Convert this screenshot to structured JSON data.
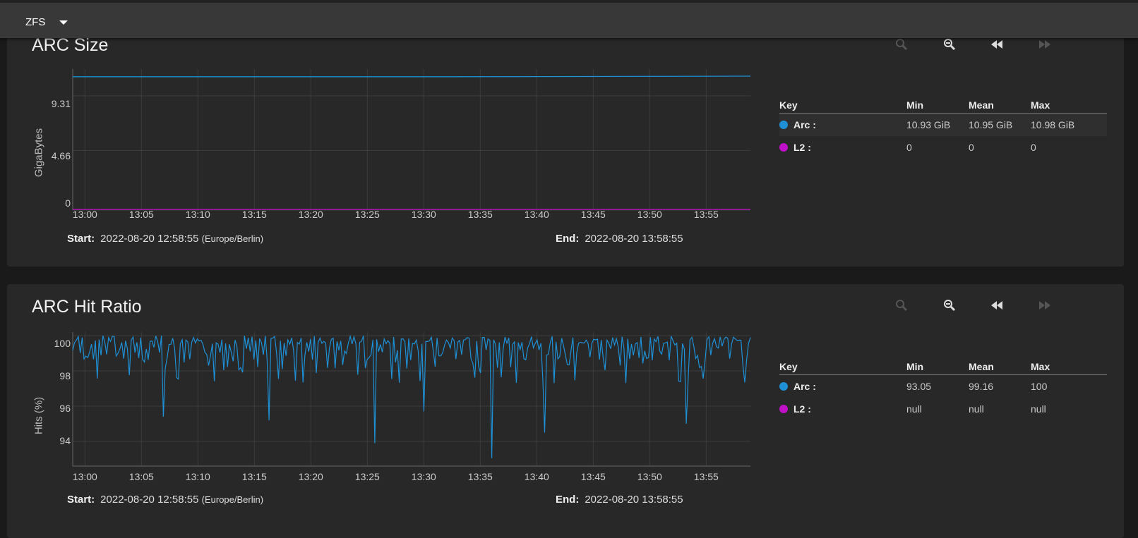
{
  "topbar": {
    "selector_value": "ZFS"
  },
  "charts": [
    {
      "title": "ARC Size",
      "ylabel": "GigaBytes",
      "yticks": [
        "9.31",
        "4.66",
        "0"
      ],
      "xticks": [
        "13:00",
        "13:05",
        "13:10",
        "13:15",
        "13:20",
        "13:25",
        "13:30",
        "13:35",
        "13:40",
        "13:45",
        "13:50",
        "13:55"
      ],
      "legend": {
        "headers": {
          "key": "Key",
          "min": "Min",
          "mean": "Mean",
          "max": "Max"
        },
        "rows": [
          {
            "name": "Arc :",
            "color": "#1e90d6",
            "min": "10.93 GiB",
            "mean": "10.95 GiB",
            "max": "10.98 GiB"
          },
          {
            "name": "L2 :",
            "color": "#c010c8",
            "min": "0",
            "mean": "0",
            "max": "0"
          }
        ]
      },
      "start_label": "Start:",
      "start_value": "2022-08-20 12:58:55",
      "start_tz": "(Europe/Berlin)",
      "end_label": "End:",
      "end_value": "2022-08-20 13:58:55"
    },
    {
      "title": "ARC Hit Ratio",
      "ylabel": "Hits (%)",
      "yticks": [
        "100",
        "98",
        "96",
        "94"
      ],
      "xticks": [
        "13:00",
        "13:05",
        "13:10",
        "13:15",
        "13:20",
        "13:25",
        "13:30",
        "13:35",
        "13:40",
        "13:45",
        "13:50",
        "13:55"
      ],
      "legend": {
        "headers": {
          "key": "Key",
          "min": "Min",
          "mean": "Mean",
          "max": "Max"
        },
        "rows": [
          {
            "name": "Arc :",
            "color": "#1e90d6",
            "min": "93.05",
            "mean": "99.16",
            "max": "100"
          },
          {
            "name": "L2 :",
            "color": "#c010c8",
            "min": "null",
            "mean": "null",
            "max": "null"
          }
        ]
      },
      "start_label": "Start:",
      "start_value": "2022-08-20 12:58:55",
      "start_tz": "(Europe/Berlin)",
      "end_label": "End:",
      "end_value": "2022-08-20 13:58:55"
    }
  ],
  "chart_data": [
    {
      "type": "line",
      "ylabel": "GigaBytes",
      "ylim": [
        0,
        12.0
      ],
      "x_range": [
        "12:58:55",
        "13:58:55"
      ],
      "series": [
        {
          "name": "Arc",
          "x": [
            "12:58:55",
            "13:32:30",
            "13:58:55"
          ],
          "values": [
            10.93,
            10.93,
            10.98
          ]
        },
        {
          "name": "L2",
          "x": [
            "12:58:55",
            "13:58:55"
          ],
          "values": [
            0,
            0
          ]
        }
      ]
    },
    {
      "type": "line",
      "ylabel": "Hits (%)",
      "ylim": [
        92.6,
        100.2
      ],
      "x_range": [
        "12:58:55",
        "13:58:55"
      ],
      "series": [
        {
          "name": "Arc",
          "min": 93.05,
          "mean": 99.16,
          "max": 100
        },
        {
          "name": "L2",
          "values": []
        }
      ]
    }
  ],
  "colors": {
    "arc": "#1e90d6",
    "l2": "#c010c8",
    "accent": "#1e90d6"
  },
  "icons": [
    "zoom-in-icon",
    "zoom-out-icon",
    "rewind-icon",
    "fast-forward-icon"
  ]
}
